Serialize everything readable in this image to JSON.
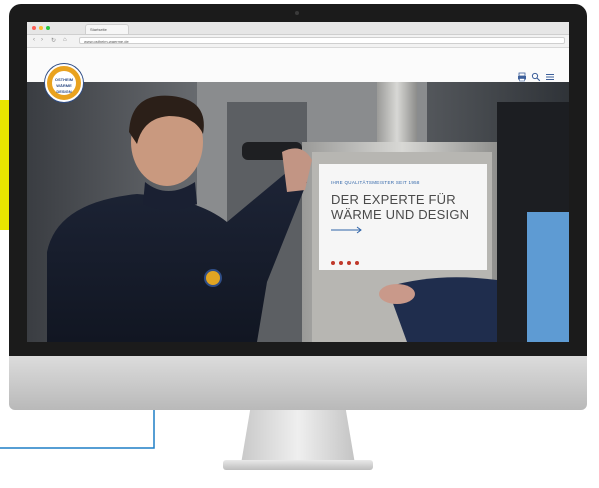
{
  "colors": {
    "accent": "#e8e600",
    "connector": "#1f7fc6",
    "brand_blue": "#2f4d86",
    "pager_dot": "#c0392b",
    "kicker": "#2f64a8"
  },
  "browser": {
    "tab_title": "Startseite",
    "url": "www.ostheim-waerme.de"
  },
  "site": {
    "logo_text": "OSTHEIM WÄRME DESIGN",
    "header_icons": [
      "print-icon",
      "search-icon",
      "menu-icon"
    ]
  },
  "hero": {
    "kicker": "IHRE QUALITÄTSMEISTER SEIT 1958",
    "headline_line1": "DER EXPERTE FÜR",
    "headline_line2": "WÄRME UND DESIGN",
    "arrow_icon": "arrow-right-icon",
    "slides": 4,
    "active_slide": 1
  }
}
